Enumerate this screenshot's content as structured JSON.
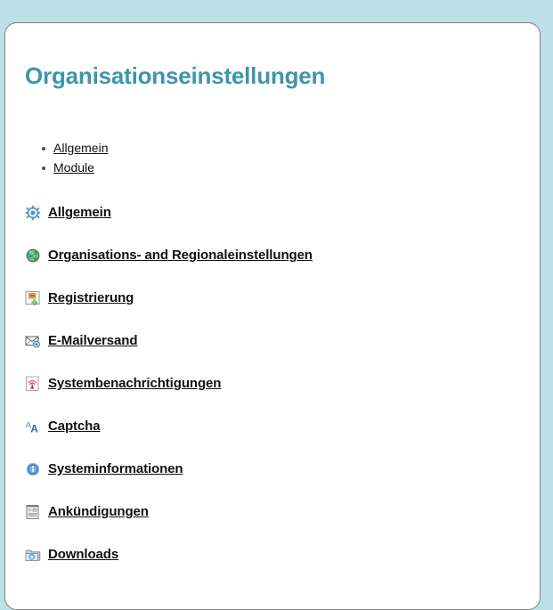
{
  "page": {
    "title": "Organisationseinstellungen",
    "title_color": "#3d96ab",
    "background_color": "#bcdfe8",
    "panel_color": "#ffffff"
  },
  "toc": {
    "items": [
      {
        "label": "Allgemein"
      },
      {
        "label": "Module"
      }
    ]
  },
  "sections": {
    "items": [
      {
        "label": "Allgemein",
        "icon": "gear-icon"
      },
      {
        "label": "Organisations- and Regionaleinstellungen",
        "icon": "globe-icon"
      },
      {
        "label": "Registrierung",
        "icon": "user-add-icon"
      },
      {
        "label": "E-Mailversand",
        "icon": "mail-settings-icon"
      },
      {
        "label": "Systembenachrichtigungen",
        "icon": "broadcast-alert-icon"
      },
      {
        "label": "Captcha",
        "icon": "font-letters-icon"
      },
      {
        "label": "Systeminformationen",
        "icon": "info-circle-icon"
      },
      {
        "label": "Ankündigungen",
        "icon": "newspaper-icon"
      },
      {
        "label": "Downloads",
        "icon": "folder-download-icon"
      }
    ]
  }
}
